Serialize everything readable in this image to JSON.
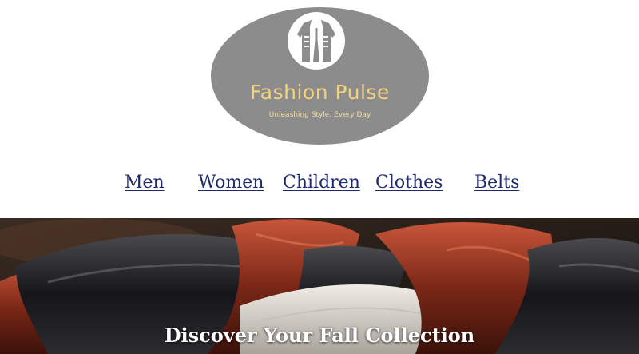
{
  "brand": {
    "name": "Fashion Pulse",
    "tagline": "Unleashing Style, Every Day",
    "logo_icon": "jacket-icon",
    "oval_color": "#8c8c8c",
    "title_color": "#f2d27a"
  },
  "nav": {
    "items": [
      {
        "label": "Men"
      },
      {
        "label": "Women"
      },
      {
        "label": "Children"
      },
      {
        "label": "Clothes"
      },
      {
        "label": "Belts"
      }
    ],
    "link_color": "#1e2a6e"
  },
  "hero": {
    "heading": "Discover Your Fall Collection",
    "image_subject": "leather jackets on a rack"
  }
}
